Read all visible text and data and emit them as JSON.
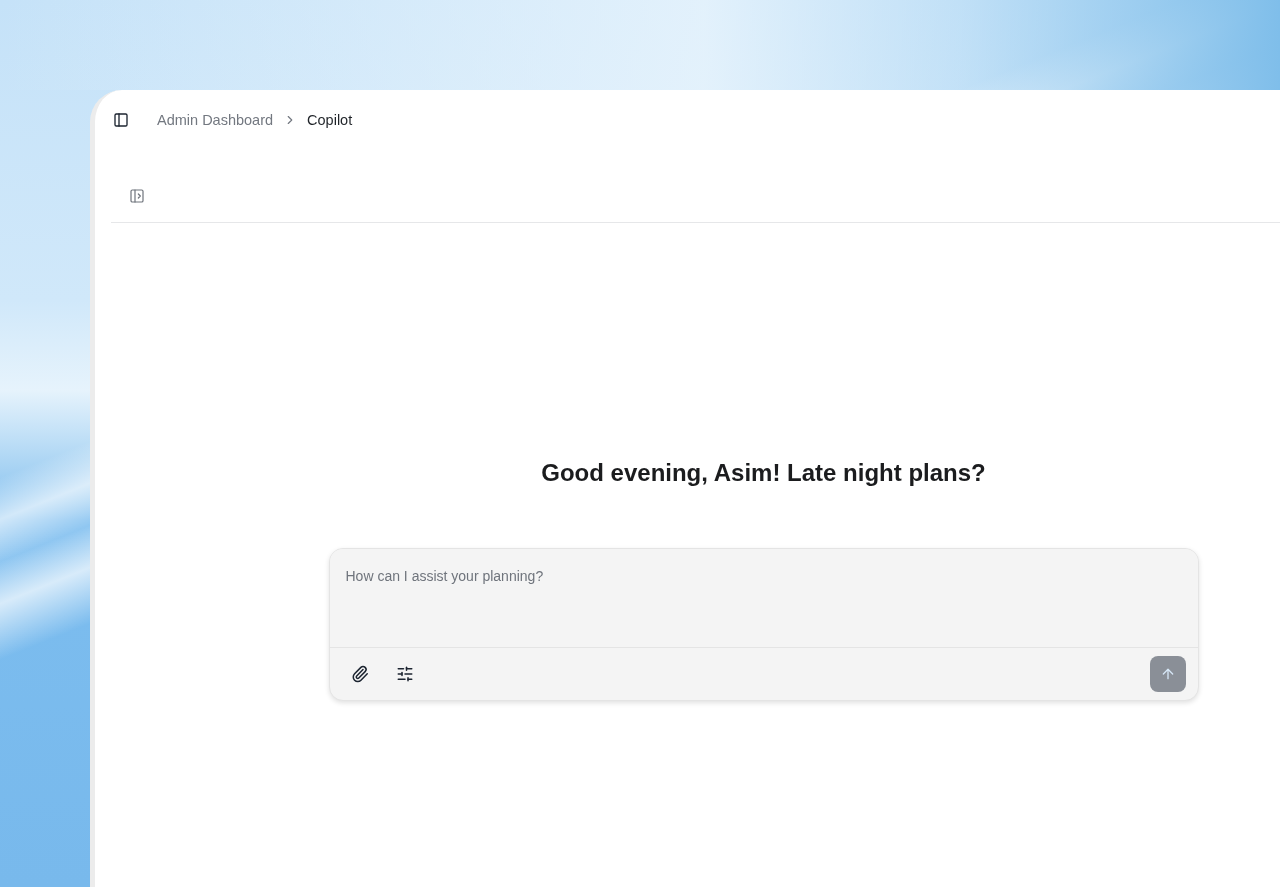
{
  "header": {
    "breadcrumb": [
      {
        "label": "Admin Dashboard",
        "current": false
      },
      {
        "label": "Copilot",
        "current": true
      }
    ]
  },
  "greeting": "Good evening, Asim! Late night plans?",
  "composer": {
    "placeholder": "How can I assist your planning?",
    "send_disabled": true
  }
}
